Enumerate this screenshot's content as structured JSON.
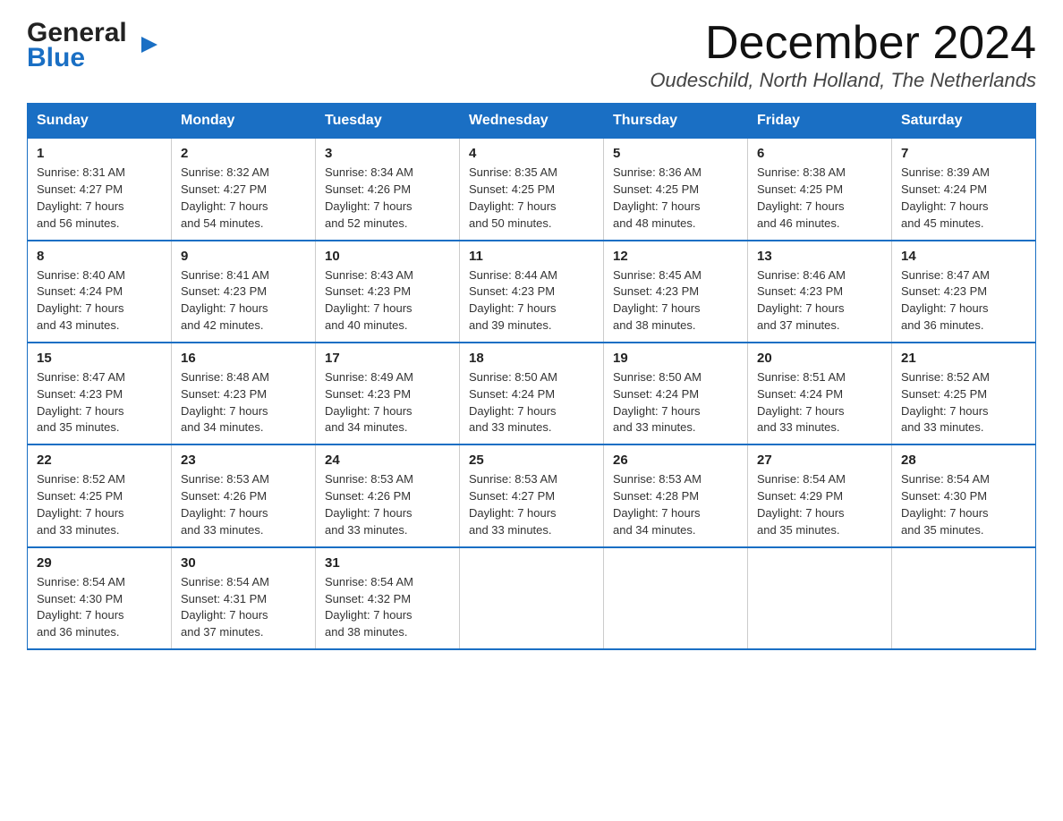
{
  "header": {
    "logo_line1": "General",
    "logo_line2": "Blue",
    "month_title": "December 2024",
    "location": "Oudeschild, North Holland, The Netherlands"
  },
  "weekdays": [
    "Sunday",
    "Monday",
    "Tuesday",
    "Wednesday",
    "Thursday",
    "Friday",
    "Saturday"
  ],
  "weeks": [
    [
      {
        "day": "1",
        "info": "Sunrise: 8:31 AM\nSunset: 4:27 PM\nDaylight: 7 hours\nand 56 minutes."
      },
      {
        "day": "2",
        "info": "Sunrise: 8:32 AM\nSunset: 4:27 PM\nDaylight: 7 hours\nand 54 minutes."
      },
      {
        "day": "3",
        "info": "Sunrise: 8:34 AM\nSunset: 4:26 PM\nDaylight: 7 hours\nand 52 minutes."
      },
      {
        "day": "4",
        "info": "Sunrise: 8:35 AM\nSunset: 4:25 PM\nDaylight: 7 hours\nand 50 minutes."
      },
      {
        "day": "5",
        "info": "Sunrise: 8:36 AM\nSunset: 4:25 PM\nDaylight: 7 hours\nand 48 minutes."
      },
      {
        "day": "6",
        "info": "Sunrise: 8:38 AM\nSunset: 4:25 PM\nDaylight: 7 hours\nand 46 minutes."
      },
      {
        "day": "7",
        "info": "Sunrise: 8:39 AM\nSunset: 4:24 PM\nDaylight: 7 hours\nand 45 minutes."
      }
    ],
    [
      {
        "day": "8",
        "info": "Sunrise: 8:40 AM\nSunset: 4:24 PM\nDaylight: 7 hours\nand 43 minutes."
      },
      {
        "day": "9",
        "info": "Sunrise: 8:41 AM\nSunset: 4:23 PM\nDaylight: 7 hours\nand 42 minutes."
      },
      {
        "day": "10",
        "info": "Sunrise: 8:43 AM\nSunset: 4:23 PM\nDaylight: 7 hours\nand 40 minutes."
      },
      {
        "day": "11",
        "info": "Sunrise: 8:44 AM\nSunset: 4:23 PM\nDaylight: 7 hours\nand 39 minutes."
      },
      {
        "day": "12",
        "info": "Sunrise: 8:45 AM\nSunset: 4:23 PM\nDaylight: 7 hours\nand 38 minutes."
      },
      {
        "day": "13",
        "info": "Sunrise: 8:46 AM\nSunset: 4:23 PM\nDaylight: 7 hours\nand 37 minutes."
      },
      {
        "day": "14",
        "info": "Sunrise: 8:47 AM\nSunset: 4:23 PM\nDaylight: 7 hours\nand 36 minutes."
      }
    ],
    [
      {
        "day": "15",
        "info": "Sunrise: 8:47 AM\nSunset: 4:23 PM\nDaylight: 7 hours\nand 35 minutes."
      },
      {
        "day": "16",
        "info": "Sunrise: 8:48 AM\nSunset: 4:23 PM\nDaylight: 7 hours\nand 34 minutes."
      },
      {
        "day": "17",
        "info": "Sunrise: 8:49 AM\nSunset: 4:23 PM\nDaylight: 7 hours\nand 34 minutes."
      },
      {
        "day": "18",
        "info": "Sunrise: 8:50 AM\nSunset: 4:24 PM\nDaylight: 7 hours\nand 33 minutes."
      },
      {
        "day": "19",
        "info": "Sunrise: 8:50 AM\nSunset: 4:24 PM\nDaylight: 7 hours\nand 33 minutes."
      },
      {
        "day": "20",
        "info": "Sunrise: 8:51 AM\nSunset: 4:24 PM\nDaylight: 7 hours\nand 33 minutes."
      },
      {
        "day": "21",
        "info": "Sunrise: 8:52 AM\nSunset: 4:25 PM\nDaylight: 7 hours\nand 33 minutes."
      }
    ],
    [
      {
        "day": "22",
        "info": "Sunrise: 8:52 AM\nSunset: 4:25 PM\nDaylight: 7 hours\nand 33 minutes."
      },
      {
        "day": "23",
        "info": "Sunrise: 8:53 AM\nSunset: 4:26 PM\nDaylight: 7 hours\nand 33 minutes."
      },
      {
        "day": "24",
        "info": "Sunrise: 8:53 AM\nSunset: 4:26 PM\nDaylight: 7 hours\nand 33 minutes."
      },
      {
        "day": "25",
        "info": "Sunrise: 8:53 AM\nSunset: 4:27 PM\nDaylight: 7 hours\nand 33 minutes."
      },
      {
        "day": "26",
        "info": "Sunrise: 8:53 AM\nSunset: 4:28 PM\nDaylight: 7 hours\nand 34 minutes."
      },
      {
        "day": "27",
        "info": "Sunrise: 8:54 AM\nSunset: 4:29 PM\nDaylight: 7 hours\nand 35 minutes."
      },
      {
        "day": "28",
        "info": "Sunrise: 8:54 AM\nSunset: 4:30 PM\nDaylight: 7 hours\nand 35 minutes."
      }
    ],
    [
      {
        "day": "29",
        "info": "Sunrise: 8:54 AM\nSunset: 4:30 PM\nDaylight: 7 hours\nand 36 minutes."
      },
      {
        "day": "30",
        "info": "Sunrise: 8:54 AM\nSunset: 4:31 PM\nDaylight: 7 hours\nand 37 minutes."
      },
      {
        "day": "31",
        "info": "Sunrise: 8:54 AM\nSunset: 4:32 PM\nDaylight: 7 hours\nand 38 minutes."
      },
      {
        "day": "",
        "info": ""
      },
      {
        "day": "",
        "info": ""
      },
      {
        "day": "",
        "info": ""
      },
      {
        "day": "",
        "info": ""
      }
    ]
  ]
}
